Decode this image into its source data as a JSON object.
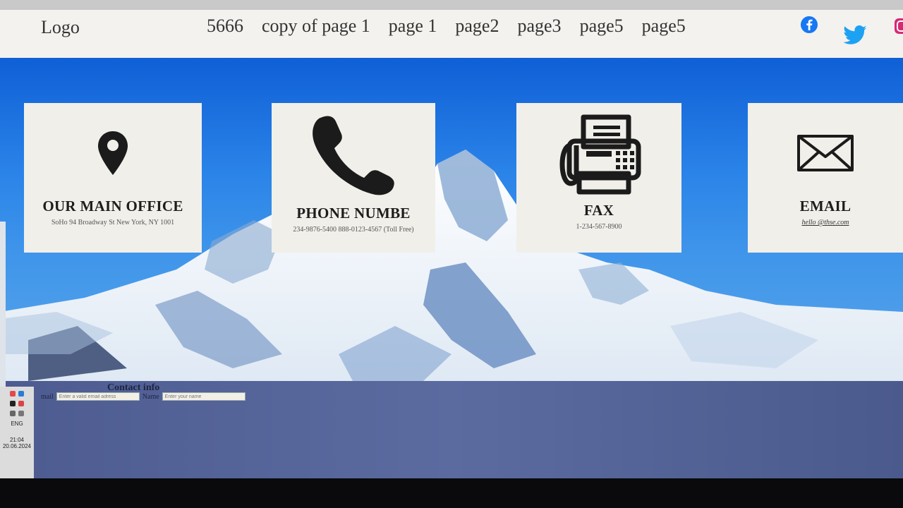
{
  "navbar": {
    "logo": "Logo",
    "links": [
      "5666",
      "copy of page 1",
      "page 1",
      "page2",
      "page3",
      "page5",
      "page5"
    ],
    "social": [
      "facebook-icon",
      "twitter-icon",
      "instagram-icon"
    ]
  },
  "cards": [
    {
      "icon": "location-pin-icon",
      "title": "OUR MAIN OFFICE",
      "text": "SoHo 94 Broadway St New York, NY 1001"
    },
    {
      "icon": "phone-icon",
      "title": "PHONE NUMBE",
      "text": "234-9876-5400 888-0123-4567 (Toll Free)"
    },
    {
      "icon": "fax-icon",
      "title": "FAX",
      "text": "1-234-567-8900"
    },
    {
      "icon": "envelope-icon",
      "title": "EMAIL",
      "link": "hello @thse.com"
    }
  ],
  "contact": {
    "title": "Contact info",
    "email_label": "mail",
    "email_placeholder": "Enter a valid email adress",
    "name_label": "Name",
    "name_placeholder": "Enter your name"
  },
  "taskbar": {
    "language": "ENG",
    "time": "21:04",
    "date": "20.06.2024"
  },
  "colors": {
    "sky": "#2a83e8",
    "card": "#f1efea",
    "contact_band": "#5564a0",
    "facebook": "#1877f2",
    "twitter": "#1da1f2"
  }
}
